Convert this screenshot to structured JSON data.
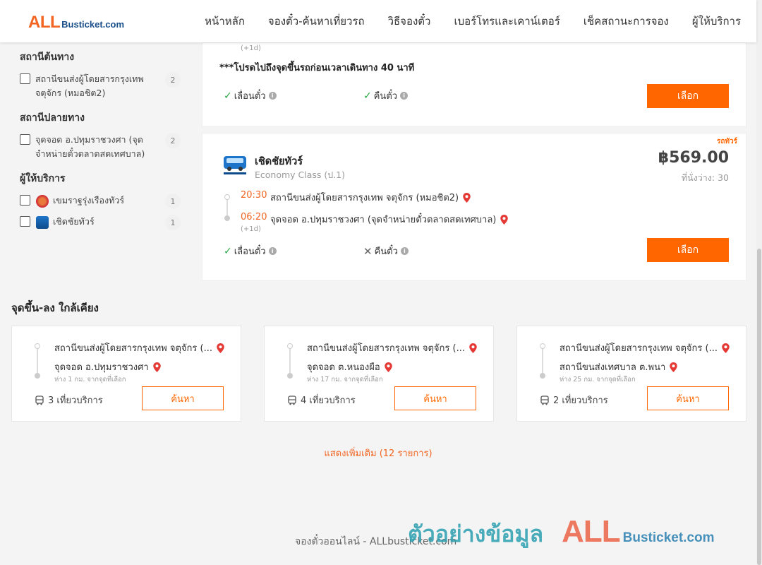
{
  "header": {
    "logo_all": "ALL",
    "logo_busticket": "Busticket.com",
    "nav": [
      "หน้าหลัก",
      "จองตั๋ว-ค้นหาเที่ยวรถ",
      "วิธีจองตั๋ว",
      "เบอร์โทรและเคาน์เตอร์",
      "เช็คสถานะการจอง",
      "ผู้ให้บริการ"
    ]
  },
  "filters": {
    "origin": {
      "title": "สถานีต้นทาง",
      "items": [
        {
          "label": "สถานีขนส่งผู้โดยสารกรุงเทพ จตุจักร (หมอชิต2)",
          "count": "2"
        }
      ]
    },
    "destination": {
      "title": "สถานีปลายทาง",
      "items": [
        {
          "label": "จุดจอด อ.ปทุมราชวงศา (จุดจำหน่ายตั๋วตลาดสดเทศบาล)",
          "count": "2"
        }
      ]
    },
    "operators": {
      "title": "ผู้ให้บริการ",
      "items": [
        {
          "label": "เขมราฐรุ่งเรืองทัวร์",
          "count": "1",
          "icon": "khemarat-logo-icon"
        },
        {
          "label": "เชิดชัยทัวร์",
          "count": "1",
          "icon": "cherdchai-logo-icon"
        }
      ]
    }
  },
  "trip1": {
    "next_day": "(+1d)",
    "notice": "***โปรดไปถึงจุดขึ้นรถก่อนเวลาเดินทาง 40 นาที",
    "feature_change": "เลื่อนตั๋ว",
    "feature_change_available": true,
    "feature_refund": "คืนตั๋ว",
    "feature_refund_available": true,
    "select_label": "เลือก"
  },
  "trip2": {
    "tag": "รถทัวร์",
    "operator": "เชิดชัยทัวร์",
    "bus_class": "Economy Class (ป.1)",
    "price": "฿569.00",
    "seats": "ที่นั่งว่าง: 30",
    "depart_time": "20:30",
    "depart_stop": "สถานีขนส่งผู้โดยสารกรุงเทพ จตุจักร (หมอชิต2)",
    "arrive_time": "06:20",
    "arrive_stop": "จุดจอด อ.ปทุมราชวงศา (จุดจำหน่ายตั๋วตลาดสดเทศบาล)",
    "next_day": "(+1d)",
    "feature_change": "เลื่อนตั๋ว",
    "feature_change_available": true,
    "feature_refund": "คืนตั๋ว",
    "feature_refund_available": false,
    "select_label": "เลือก"
  },
  "nearby": {
    "title": "จุดขึ้น-ลง ใกล้เคียง",
    "items": [
      {
        "from": "สถานีขนส่งผู้โดยสารกรุงเทพ จตุจักร (...",
        "to": "จุดจอด อ.ปทุมราชวงศา",
        "distance": "ห่าง 1 กม. จากจุดที่เลือก",
        "trips": "3 เที่ยวบริการ",
        "button": "ค้นหา"
      },
      {
        "from": "สถานีขนส่งผู้โดยสารกรุงเทพ จตุจักร (...",
        "to": "จุดจอด ต.หนองผือ",
        "distance": "ห่าง 17 กม. จากจุดที่เลือก",
        "trips": "4 เที่ยวบริการ",
        "button": "ค้นหา"
      },
      {
        "from": "สถานีขนส่งผู้โดยสารกรุงเทพ จตุจักร (...",
        "to": "สถานีขนส่งเทศบาล ต.พนา",
        "distance": "ห่าง 25 กม. จากจุดที่เลือก",
        "trips": "2 เที่ยวบริการ",
        "button": "ค้นหา"
      }
    ],
    "more": "แสดงเพิ่มเติม (12 รายการ)"
  },
  "footer": {
    "text": "จองตั๋วออนไลน์ - ALLbusticket.com"
  },
  "watermark": {
    "thai": "ตัวอย่างข้อมูล",
    "all": "ALL",
    "busticket": "Busticket.com"
  },
  "colors": {
    "accent": "#ff6600",
    "time": "#f26522",
    "check": "#27a844",
    "pin": "#e53935"
  }
}
